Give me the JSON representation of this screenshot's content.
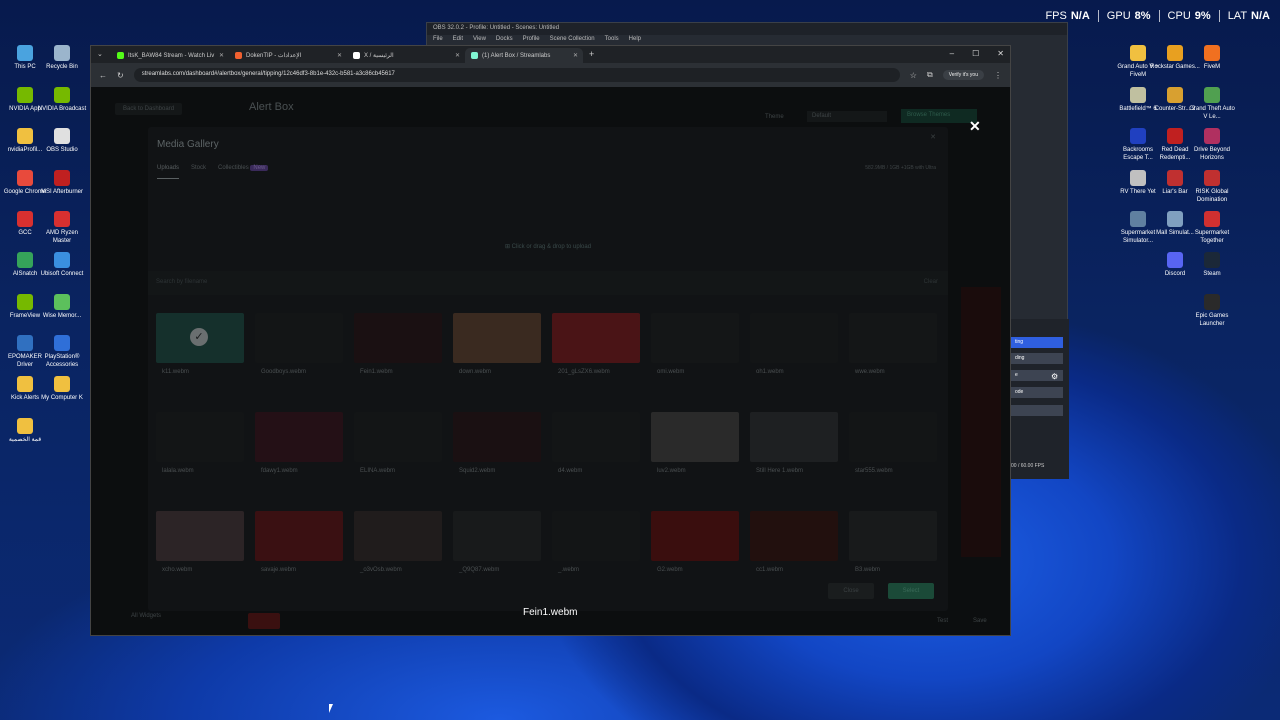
{
  "stats": {
    "fps_label": "FPS",
    "fps": "N/A",
    "gpu_label": "GPU",
    "gpu": "8%",
    "cpu_label": "CPU",
    "cpu": "9%",
    "lat_label": "LAT",
    "lat": "N/A"
  },
  "desktop_left": [
    {
      "label": "This PC",
      "color": "#4aa3df"
    },
    {
      "label": "Recycle Bin",
      "color": "#9bb5cc"
    },
    {
      "label": "NVIDIA App",
      "color": "#76b900"
    },
    {
      "label": "NVIDIA Broadcast",
      "color": "#76b900"
    },
    {
      "label": "nvidiaProfil...",
      "color": "#f0c040"
    },
    {
      "label": "OBS Studio",
      "color": "#e0e0e0"
    },
    {
      "label": "Google Chrome",
      "color": "#e84a3c"
    },
    {
      "label": "MSI Afterburner",
      "color": "#c02020"
    },
    {
      "label": "GCC",
      "color": "#d83030"
    },
    {
      "label": "AMD Ryzen Master",
      "color": "#d83030"
    },
    {
      "label": "AISnatch",
      "color": "#35a35a"
    },
    {
      "label": "Ubisoft Connect",
      "color": "#3a8fe0"
    },
    {
      "label": "FrameView",
      "color": "#76b900"
    },
    {
      "label": "Wise Memor...",
      "color": "#5cc05c"
    },
    {
      "label": "EPOMAKER Driver",
      "color": "#3070c0"
    },
    {
      "label": "PlayStation® Accessories",
      "color": "#2f6fd8"
    },
    {
      "label": "Kick Alerts",
      "color": "#f0c040"
    },
    {
      "label": "My Computer K",
      "color": "#f0c040"
    },
    {
      "label": "قمة الخصمية",
      "color": "#f0c040"
    }
  ],
  "desktop_right": [
    {
      "label": "Grand Auto V + FiveM",
      "color": "#f0c040"
    },
    {
      "label": "Rockstar Games...",
      "color": "#e8a020"
    },
    {
      "label": "FiveM",
      "color": "#f07020"
    },
    {
      "label": "Battlefield™ 6",
      "color": "#c0c0a0"
    },
    {
      "label": "Counter-Str... 2",
      "color": "#d8a030"
    },
    {
      "label": "Grand Theft Auto V Le...",
      "color": "#50a050"
    },
    {
      "label": "Backrooms Escape T...",
      "color": "#2040c0"
    },
    {
      "label": "Red Dead Redempti...",
      "color": "#c02020"
    },
    {
      "label": "Drive Beyond Horizons",
      "color": "#b03060"
    },
    {
      "label": "RV There Yet",
      "color": "#c0c0c0"
    },
    {
      "label": "Liar's Bar",
      "color": "#c03030"
    },
    {
      "label": "RISK Global Domination",
      "color": "#c03030"
    },
    {
      "label": "Supermarket Simulator...",
      "color": "#6080a0"
    },
    {
      "label": "Mall Simulat...",
      "color": "#80a0c0"
    },
    {
      "label": "Supermarket Together",
      "color": "#d03030"
    },
    {
      "label": "Discord",
      "color": "#5865f2"
    },
    {
      "label": "Steam",
      "color": "#1b2838"
    },
    {
      "label": "Epic Games Launcher",
      "color": "#2a2a2a"
    }
  ],
  "obs": {
    "title": "OBS 32.0.2 - Profile: Untitled - Scenes: Untitled",
    "menu": [
      "File",
      "Edit",
      "View",
      "Docks",
      "Profile",
      "Scene Collection",
      "Tools",
      "Help"
    ],
    "fps_status": "00 / 60.00 FPS",
    "btn1": "ting",
    "btn2": "ding",
    "btn3": "ode",
    "btn4": "e"
  },
  "browser": {
    "tabs": [
      {
        "title": "ItsK_BAW84 Stream - Watch Liv",
        "color": "#53fc18"
      },
      {
        "title": "DokenTIP - الإعدادات",
        "color": "#f06030"
      },
      {
        "title": "X / الرئيسية",
        "color": "#ffffff"
      },
      {
        "title": "(1) Alert Box / Streamlabs",
        "color": "#80f5d2"
      }
    ],
    "url": "streamlabs.com/dashboard#/alertbox/general/tipping/12c46df3-8b1e-432c-b581-a3c86cb45617",
    "verify": "Verify it's you"
  },
  "page": {
    "back": "Back to Dashboard",
    "title": "Alert Box",
    "theme": "Theme",
    "theme_value": "Default",
    "browse": "Browse Themes",
    "all_widgets": "All Widgets",
    "test": "Test",
    "save": "Save"
  },
  "modal": {
    "title": "Media Gallery",
    "tabs": [
      "Uploads",
      "Stock",
      "Collectibles"
    ],
    "new_badge": "New",
    "storage": "582.9MB / 1GB   +1GB with Ultra",
    "upload": "Click or drag & drop to upload",
    "search": "Search by filename",
    "clear": "Clear",
    "items": [
      {
        "name": "k11.webm",
        "color": "#15302c",
        "check": true
      },
      {
        "name": "Goodboys.webm",
        "color": "#131516"
      },
      {
        "name": "Fein1.webm",
        "color": "#1a1012"
      },
      {
        "name": "down.webm",
        "color": "#3a2a20"
      },
      {
        "name": "201_gLsZX6.webm",
        "color": "#4a1416"
      },
      {
        "name": "omi.webm",
        "color": "#141617"
      },
      {
        "name": "oh1.webm",
        "color": "#131516"
      },
      {
        "name": "wwe.webm",
        "color": "#141617"
      },
      {
        "name": "lalala.webm",
        "color": "#131516"
      },
      {
        "name": "fdawy1.webm",
        "color": "#241016"
      },
      {
        "name": "ELINA.webm",
        "color": "#131516"
      },
      {
        "name": "Squid2.webm",
        "color": "#1a1012"
      },
      {
        "name": "d4.webm",
        "color": "#131516"
      },
      {
        "name": "luv2.webm",
        "color": "#2a2a2a"
      },
      {
        "name": "Still Here 1.webm",
        "color": "#1e2022"
      },
      {
        "name": "star555.webm",
        "color": "#131516"
      },
      {
        "name": "xcho.webm",
        "color": "#2c2426"
      },
      {
        "name": "savaje.webm",
        "color": "#3a1012"
      },
      {
        "name": "_o3vOsb.webm",
        "color": "#201c1c"
      },
      {
        "name": "_Q9Q87.webm",
        "color": "#181a1b"
      },
      {
        "name": "_.webm",
        "color": "#131516"
      },
      {
        "name": "G2.webm",
        "color": "#3a0e0e"
      },
      {
        "name": "cc1.webm",
        "color": "#22100e"
      },
      {
        "name": "B3.webm",
        "color": "#181a1b"
      }
    ],
    "close": "Close",
    "select": "Select"
  },
  "caption": "Fein1.webm"
}
